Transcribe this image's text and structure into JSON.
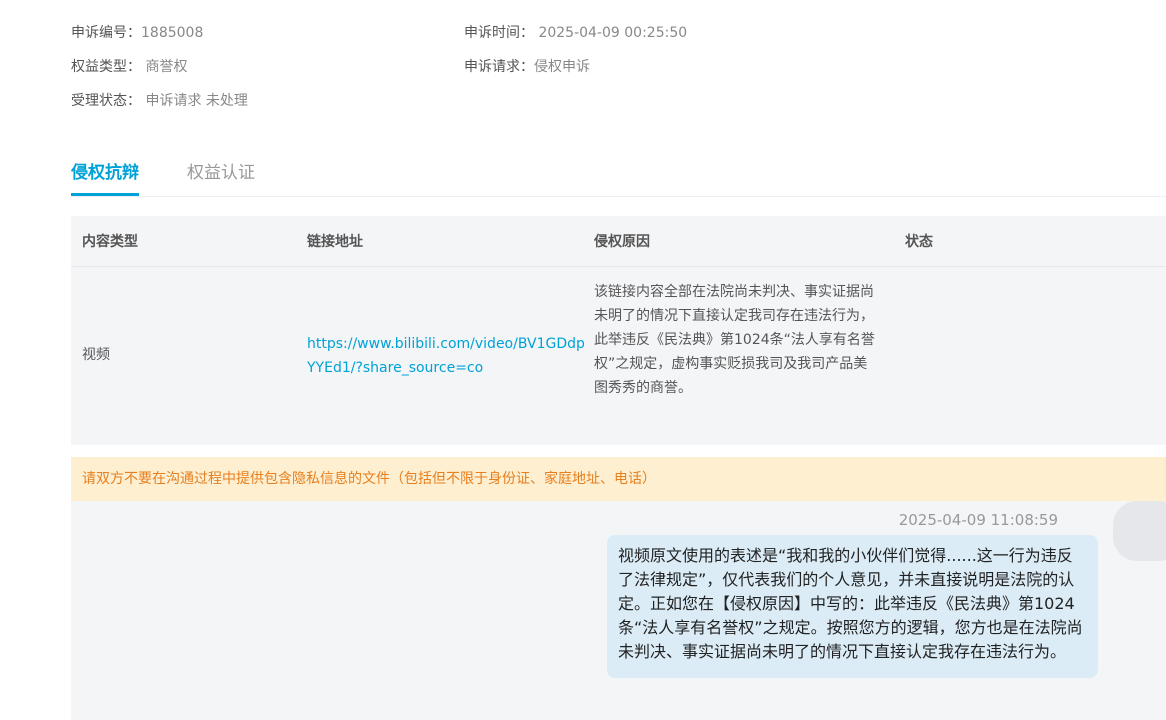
{
  "info": {
    "complaint_id_label": "申诉编号：",
    "complaint_id_value": "1885008",
    "complaint_time_label": "申诉时间：",
    "complaint_time_value": "2025-04-09 00:25:50",
    "rights_type_label": "权益类型：",
    "rights_type_value": "商誉权",
    "request_label": "申诉请求：",
    "request_value": "侵权申诉",
    "status_label": "受理状态：",
    "status_value": "申诉请求 未处理"
  },
  "tabs": [
    {
      "label": "侵权抗辩",
      "active": true
    },
    {
      "label": "权益认证",
      "active": false
    }
  ],
  "table": {
    "headers": [
      "内容类型",
      "链接地址",
      "侵权原因",
      "状态"
    ],
    "rows": [
      {
        "type": "视频",
        "link": "https://www.bilibili.com/video/BV1GDdpYYEd1/?share_source=co",
        "reason": "该链接内容全部在法院尚未判决、事实证据尚未明了的情况下直接认定我司存在违法行为，此举违反《民法典》第1024条“法人享有名誉权”之规定，虚构事实贬损我司及我司产品美图秀秀的商誉。",
        "status": ""
      }
    ]
  },
  "notice": "请双方不要在沟通过程中提供包含隐私信息的文件（包括但不限于身份证、家庭地址、电话）",
  "chat": {
    "messages": [
      {
        "time": "2025-04-09 11:08:59",
        "text": "视频原文使用的表述是“我和我的小伙伴们觉得......这一行为违反了法律规定”，仅代表我们的个人意见，并未直接说明是法院的认定。正如您在【侵权原因】中写的：此举违反《民法典》第1024条“法人享有名誉权”之规定。按照您方的逻辑，您方也是在法院尚未判决、事实证据尚未明了的情况下直接认定我存在违法行为。"
      }
    ]
  },
  "colors": {
    "accent": "#00a1d6",
    "notice_bg": "#fdefd0",
    "notice_text": "#e87f1e",
    "bubble_bg": "#dbecf7"
  }
}
